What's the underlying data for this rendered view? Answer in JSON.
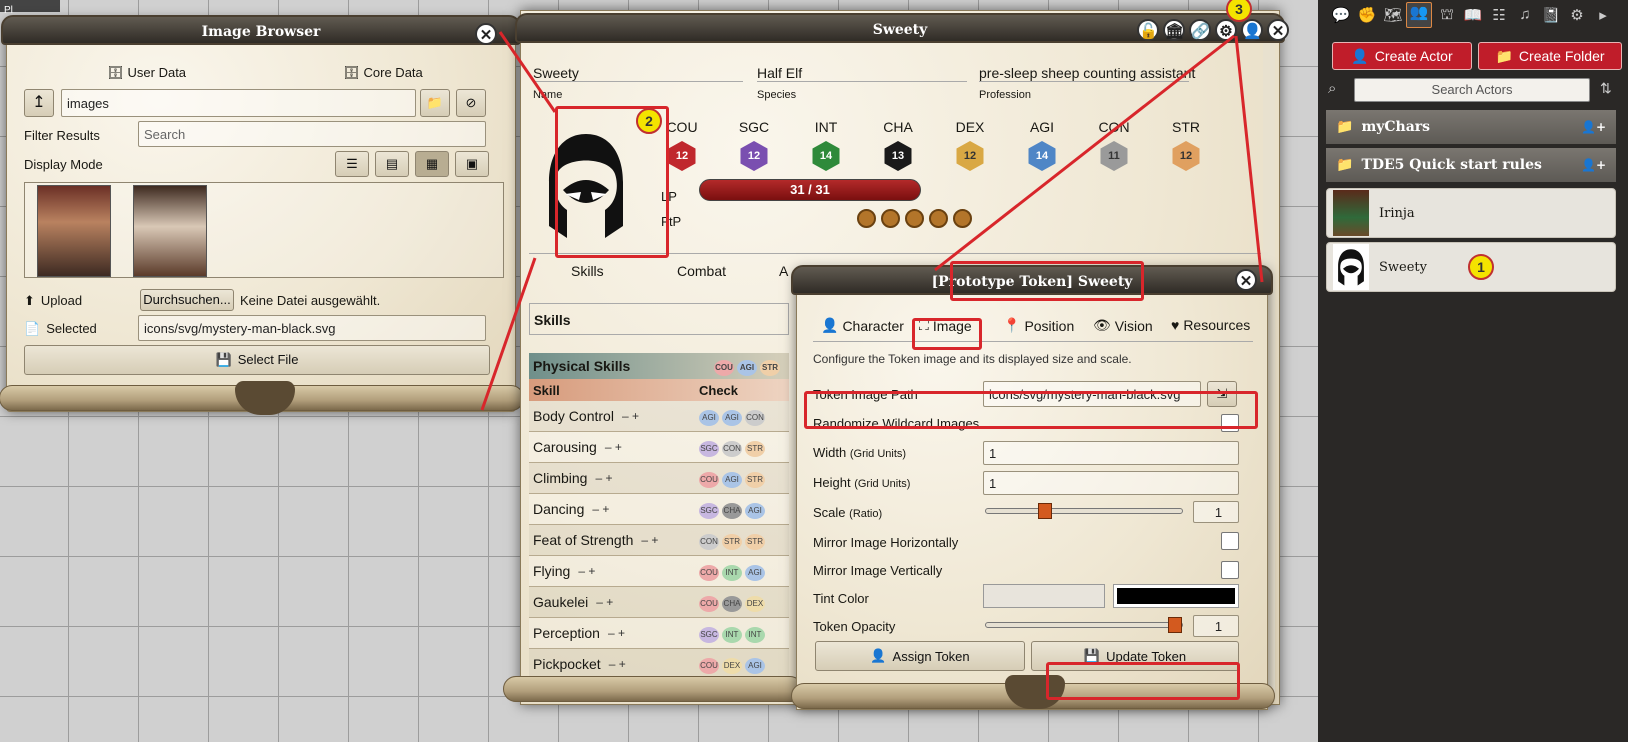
{
  "image_browser": {
    "title": "Image Browser",
    "user_data": "User Data",
    "core_data": "Core Data",
    "path": "images",
    "filter_label": "Filter Results",
    "filter_placeholder": "Search",
    "display_mode": "Display Mode",
    "upload_label": "Upload",
    "browse_button": "Durchsuchen...",
    "no_file": "Keine Datei ausgewählt.",
    "selected_label": "Selected",
    "selected_value": "icons/svg/mystery-man-black.svg",
    "select_file": "Select File",
    "top_left_label": "Pl"
  },
  "actor_sheet": {
    "title": "Sweety",
    "name": "Sweety",
    "name_label": "Name",
    "species": "Half Elf",
    "species_label": "Species",
    "profession": "pre-sleep sheep counting assistant",
    "profession_label": "Profession",
    "attributes": [
      {
        "name": "COU",
        "value": "12",
        "color": "#c0282d"
      },
      {
        "name": "SGC",
        "value": "12",
        "color": "#7a4fb0"
      },
      {
        "name": "INT",
        "value": "14",
        "color": "#2f8a3a"
      },
      {
        "name": "CHA",
        "value": "13",
        "color": "#1a1a1a"
      },
      {
        "name": "DEX",
        "value": "12",
        "color": "#d9a844"
      },
      {
        "name": "AGI",
        "value": "14",
        "color": "#4f86c6"
      },
      {
        "name": "CON",
        "value": "11",
        "color": "#9a9a9a"
      },
      {
        "name": "STR",
        "value": "12",
        "color": "#e0a060"
      }
    ],
    "lp_label": "LP",
    "lp_value": "31 / 31",
    "ftp_label": "FtP",
    "tabs": [
      "Skills",
      "Combat",
      "A"
    ],
    "skills_header": "Skills",
    "physical_skills": "Physical Skills",
    "physical_attrs": [
      "COU",
      "AGI",
      "STR"
    ],
    "col_skill": "Skill",
    "col_check": "Check",
    "skills": [
      {
        "name": "Body Control",
        "check": [
          "AGI",
          "AGI",
          "CON"
        ],
        "colors": [
          "#aac4e6",
          "#aac4e6",
          "#ccc"
        ]
      },
      {
        "name": "Carousing",
        "check": [
          "SGC",
          "CON",
          "STR"
        ],
        "colors": [
          "#c7b7e0",
          "#ccc",
          "#f0cfa8"
        ]
      },
      {
        "name": "Climbing",
        "check": [
          "COU",
          "AGI",
          "STR"
        ],
        "colors": [
          "#eda9a9",
          "#aac4e6",
          "#f0cfa8"
        ]
      },
      {
        "name": "Dancing",
        "check": [
          "SGC",
          "CHA",
          "AGI"
        ],
        "colors": [
          "#c7b7e0",
          "#999",
          "#aac4e6"
        ]
      },
      {
        "name": "Feat of Strength",
        "check": [
          "CON",
          "STR",
          "STR"
        ],
        "colors": [
          "#ccc",
          "#f0cfa8",
          "#f0cfa8"
        ]
      },
      {
        "name": "Flying",
        "check": [
          "COU",
          "INT",
          "AGI"
        ],
        "colors": [
          "#eda9a9",
          "#a9d8ad",
          "#aac4e6"
        ]
      },
      {
        "name": "Gaukelei",
        "check": [
          "COU",
          "CHA",
          "DEX"
        ],
        "colors": [
          "#eda9a9",
          "#999",
          "#eedcaa"
        ]
      },
      {
        "name": "Perception",
        "check": [
          "SGC",
          "INT",
          "INT"
        ],
        "colors": [
          "#c7b7e0",
          "#a9d8ad",
          "#a9d8ad"
        ]
      },
      {
        "name": "Pickpocket",
        "check": [
          "COU",
          "DEX",
          "AGI"
        ],
        "colors": [
          "#eda9a9",
          "#eedcaa",
          "#aac4e6"
        ]
      }
    ]
  },
  "token": {
    "title": "[Prototype Token] Sweety",
    "tabs": [
      "Character",
      "Image",
      "Position",
      "Vision",
      "Resources"
    ],
    "description": "Configure the Token image and its displayed size and scale.",
    "path_label": "Token Image Path",
    "path_value": "icons/svg/mystery-man-black.svg",
    "randomize": "Randomize Wildcard Images",
    "width_label": "Width",
    "width_unit": "(Grid Units)",
    "width_value": "1",
    "height_label": "Height",
    "height_unit": "(Grid Units)",
    "height_value": "1",
    "scale_label": "Scale",
    "scale_unit": "(Ratio)",
    "scale_value": "1",
    "scale_fraction": 0.3,
    "mirror_h": "Mirror Image Horizontally",
    "mirror_v": "Mirror Image Vertically",
    "tint_label": "Tint Color",
    "opacity_label": "Token Opacity",
    "opacity_value": "1",
    "opacity_fraction": 1.0,
    "assign": "Assign Token",
    "update": "Update Token"
  },
  "sidebar": {
    "create_actor": "Create Actor",
    "create_folder": "Create Folder",
    "search_placeholder": "Search Actors",
    "folders": [
      "myChars",
      "TDE5 Quick start rules"
    ],
    "actors": [
      "Irinja",
      "Sweety"
    ]
  },
  "badges": [
    "1",
    "2",
    "3"
  ]
}
